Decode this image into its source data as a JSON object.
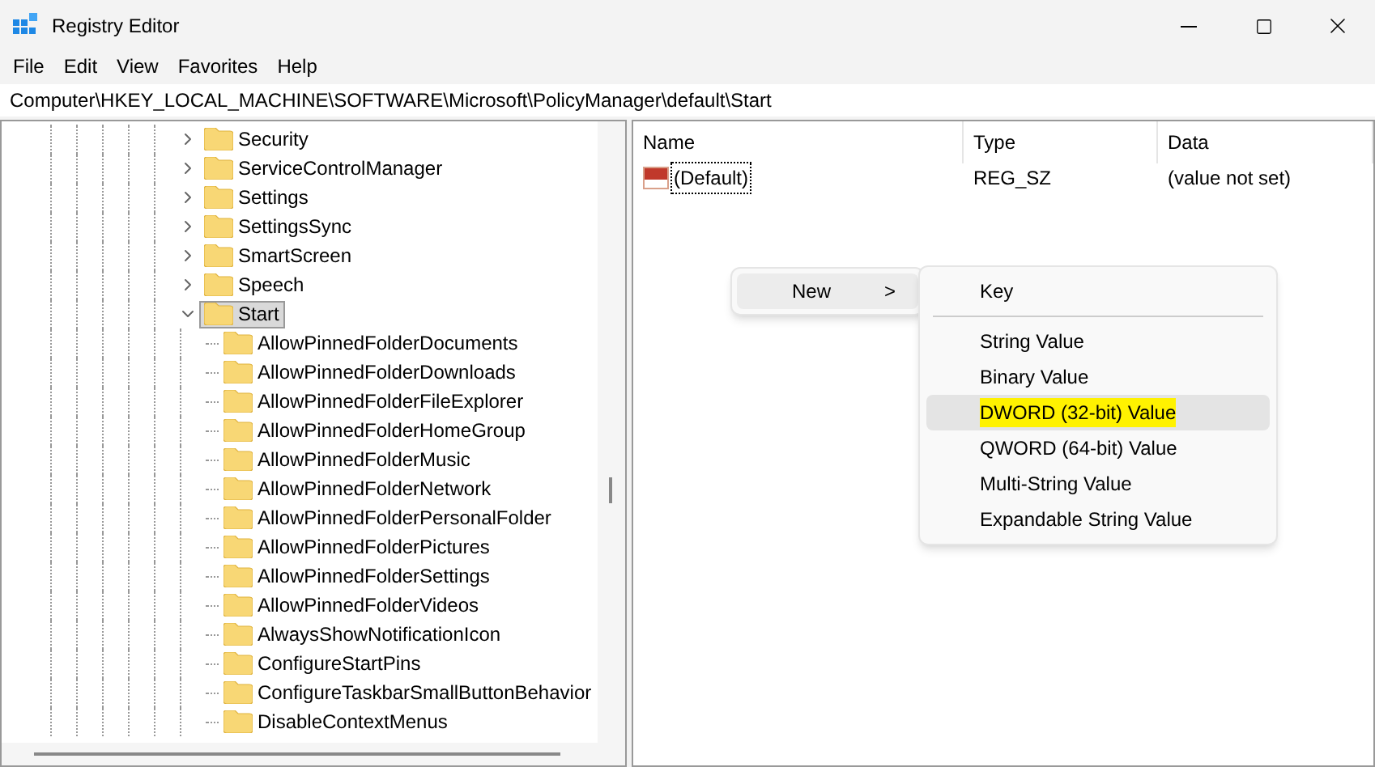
{
  "window": {
    "title": "Registry Editor"
  },
  "menu": [
    "File",
    "Edit",
    "View",
    "Favorites",
    "Help"
  ],
  "address": "Computer\\HKEY_LOCAL_MACHINE\\SOFTWARE\\Microsoft\\PolicyManager\\default\\Start",
  "tree": [
    {
      "label": "Security",
      "expanded": false,
      "selected": false
    },
    {
      "label": "ServiceControlManager",
      "expanded": false,
      "selected": false
    },
    {
      "label": "Settings",
      "expanded": false,
      "selected": false
    },
    {
      "label": "SettingsSync",
      "expanded": false,
      "selected": false
    },
    {
      "label": "SmartScreen",
      "expanded": false,
      "selected": false
    },
    {
      "label": "Speech",
      "expanded": false,
      "selected": false
    },
    {
      "label": "Start",
      "expanded": true,
      "selected": true,
      "children": [
        {
          "label": "AllowPinnedFolderDocuments",
          "selected": false
        },
        {
          "label": "AllowPinnedFolderDownloads",
          "selected": false
        },
        {
          "label": "AllowPinnedFolderFileExplorer",
          "selected": false
        },
        {
          "label": "AllowPinnedFolderHomeGroup",
          "selected": false
        },
        {
          "label": "AllowPinnedFolderMusic",
          "selected": false
        },
        {
          "label": "AllowPinnedFolderNetwork",
          "selected": false
        },
        {
          "label": "AllowPinnedFolderPersonalFolder",
          "selected": false
        },
        {
          "label": "AllowPinnedFolderPictures",
          "selected": false
        },
        {
          "label": "AllowPinnedFolderSettings",
          "selected": false
        },
        {
          "label": "AllowPinnedFolderVideos",
          "selected": false
        },
        {
          "label": "AlwaysShowNotificationIcon",
          "selected": false
        },
        {
          "label": "ConfigureStartPins",
          "selected": false
        },
        {
          "label": "ConfigureTaskbarSmallButtonBehavior",
          "selected": false
        },
        {
          "label": "DisableContextMenus",
          "selected": false
        }
      ]
    }
  ],
  "table": {
    "columns": [
      "Name",
      "Type",
      "Data"
    ],
    "rows": [
      {
        "name": "(Default)",
        "type": "REG_SZ",
        "data": "(value not set)",
        "selected": true
      }
    ]
  },
  "context_menu": {
    "item": "New",
    "arrow": ">",
    "submenu": [
      {
        "label": "Key",
        "selected": false,
        "highlighted": false
      },
      {
        "kind": "separator"
      },
      {
        "label": "String Value",
        "selected": false,
        "highlighted": false
      },
      {
        "label": "Binary Value",
        "selected": false,
        "highlighted": false
      },
      {
        "label": "DWORD (32-bit) Value",
        "selected": true,
        "highlighted": true
      },
      {
        "label": "QWORD (64-bit) Value",
        "selected": false,
        "highlighted": false
      },
      {
        "label": "Multi-String Value",
        "selected": false,
        "highlighted": false
      },
      {
        "label": "Expandable String Value",
        "selected": false,
        "highlighted": false
      }
    ]
  }
}
